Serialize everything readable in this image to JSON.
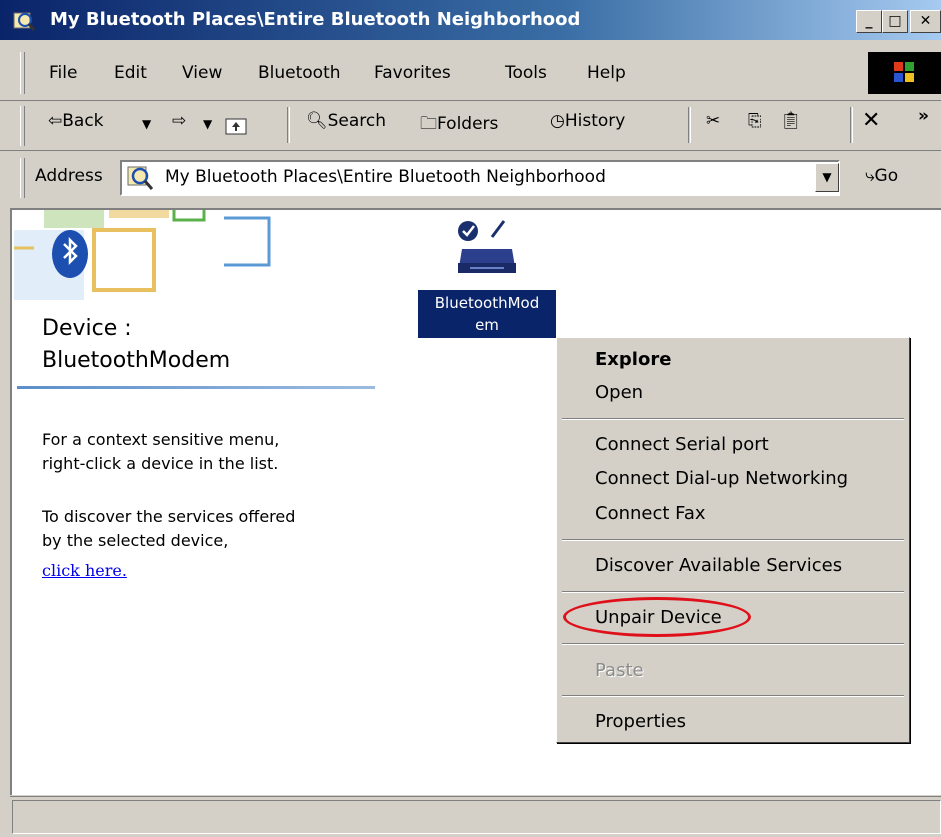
{
  "window": {
    "title": "My Bluetooth Places\\Entire Bluetooth Neighborhood",
    "minimize_glyph": "_",
    "maximize_glyph": "□",
    "close_glyph": "✕"
  },
  "menubar": {
    "items": [
      "File",
      "Edit",
      "View",
      "Bluetooth",
      "Favorites",
      "Tools",
      "Help"
    ]
  },
  "toolbar": {
    "back_label": "Back",
    "search_label": "Search",
    "folders_label": "Folders",
    "history_label": "History",
    "overflow_label": "»"
  },
  "address": {
    "label": "Address",
    "value": "My Bluetooth Places\\Entire Bluetooth Neighborhood",
    "go_label": "Go"
  },
  "left_panel": {
    "device_heading_1": "Device :",
    "device_heading_2": "BluetoothModem",
    "info_line_1": "For a context sensitive menu,",
    "info_line_2": "right-click a device in the list.",
    "info_line_3": "To discover the services offered",
    "info_line_4": "by the selected device,",
    "link_text": "click here."
  },
  "device": {
    "label_line_1": "BluetoothMod",
    "label_line_2": "em"
  },
  "context_menu": {
    "explore": "Explore",
    "open": "Open",
    "connect_serial": "Connect Serial port",
    "connect_dialup": "Connect Dial-up Networking",
    "connect_fax": "Connect Fax",
    "discover": "Discover Available Services",
    "unpair": "Unpair Device",
    "paste": "Paste",
    "properties": "Properties"
  },
  "colors": {
    "title_bar": "#0a246a",
    "selection": "#0a246a",
    "highlight_circle": "#e0101a",
    "link": "#0000ee"
  }
}
